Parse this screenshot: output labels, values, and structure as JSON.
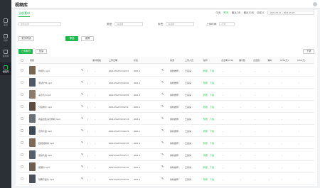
{
  "sidebar": {
    "items": [
      {
        "icon": "home-icon",
        "label": "首页"
      },
      {
        "icon": "edit-icon",
        "label": "创作"
      },
      {
        "icon": "library-icon",
        "label": "素材库"
      },
      {
        "icon": "video-library-icon",
        "label": "视频库"
      }
    ],
    "active_index": 3
  },
  "header": {
    "title": "视频库"
  },
  "tabs": {
    "main": "全部素材"
  },
  "range_tabs": [
    "今天",
    "昨天",
    "最近7天",
    "最近30天",
    "自定义"
  ],
  "date_range": "2021-05-01 ~ 2021-05-28",
  "filters": {
    "search_placeholder": "搜索名称",
    "type_label": "类型:",
    "type_value": "请选择",
    "tag_label": "标签:",
    "tag_value": "请选择",
    "date_label": "上传时间:",
    "date_value": "不限"
  },
  "actions": {
    "more": "更多筛选",
    "search": "筛选",
    "reset": "重置"
  },
  "toolbar": {
    "upload": "上传素材",
    "batch": "批量",
    "export": "下载"
  },
  "columns": [
    "视频",
    "素材规格",
    "上传日期",
    "标签",
    "来源",
    "上传人员",
    "操作",
    "点击率(CTR)",
    "展示数",
    "点击数",
    "消耗",
    "CPM(元)",
    "CPC(元)"
  ],
  "rows": [
    {
      "name": "外観片.mp4",
      "date": "2021-05-28 16:02:04",
      "tag": "2021.1",
      "source": "素材推荐",
      "uploader": "王某某"
    },
    {
      "name": "测试CTR.mp4",
      "date": "2021-05-28 16:02:06",
      "tag": "2021.1",
      "source": "素材推荐",
      "uploader": "王某某"
    },
    {
      "name": "演示片1.mp4",
      "date": "2021-05-28 16:02:09",
      "tag": "2021.1",
      "source": "素材推荐",
      "uploader": "王某某"
    },
    {
      "name": "分镜样片.mp4",
      "date": "2021-05-28 16:02:11",
      "tag": "2021.1",
      "source": "素材推荐",
      "uploader": "王某某"
    },
    {
      "name": "商品合集演示样机.mp4",
      "date": "2021-05-28 16:02:13",
      "tag": "2021.1",
      "source": "素材推荐",
      "uploader": "王某某"
    },
    {
      "name": "宣传片金.mp4",
      "date": "2021-05-28 16:02:15",
      "tag": "2021.1",
      "source": "素材推荐",
      "uploader": "王某某"
    },
    {
      "name": "短视频素材.mp4",
      "date": "2021-05-28 16:02:15",
      "tag": "2021.1",
      "source": "素材推荐",
      "uploader": "王某某"
    },
    {
      "name": "活动片段.mp4",
      "date": "2021-05-28 16:02:17",
      "tag": "2021.1",
      "source": "素材推荐",
      "uploader": "王某某"
    },
    {
      "name": "促销片.mp4",
      "date": "2021-05-28 16:02:19",
      "tag": "2021.1",
      "source": "素材推荐",
      "uploader": "王某某"
    },
    {
      "name": "到期产品片.mp4",
      "date": "2021-05-28 16:02:20",
      "tag": "2021.1",
      "source": "素材推荐",
      "uploader": "王某某"
    }
  ],
  "row_action_labels": {
    "view": "预览",
    "download": "下载"
  },
  "placeholder_value": "-",
  "accent_color": "#1eb84c"
}
